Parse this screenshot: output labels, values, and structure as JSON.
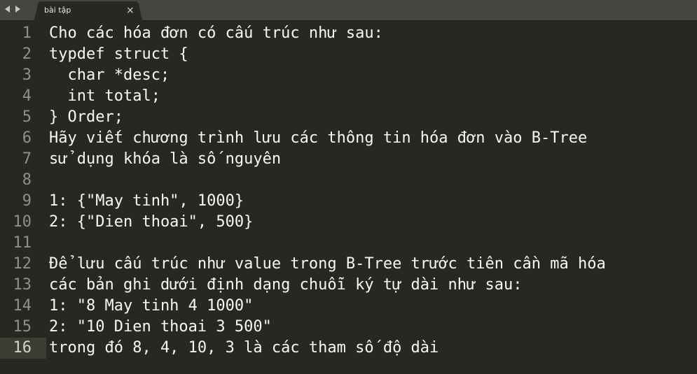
{
  "tab": {
    "title": "bài tập",
    "close_glyph": "×"
  },
  "nav": {
    "back_icon": "chevron-left-icon",
    "forward_icon": "chevron-right-icon"
  },
  "colors": {
    "background": "#272822",
    "tabbar": "#45463f",
    "text": "#f8f8f2",
    "gutter": "#8f908a",
    "current_line": "#3e3d32"
  },
  "editor": {
    "current_line": 16,
    "lines": [
      {
        "num": "1",
        "text": "Cho các hóa đơn có cấu trúc như sau:"
      },
      {
        "num": "2",
        "text": "typdef struct {"
      },
      {
        "num": "3",
        "text": "  char *desc;"
      },
      {
        "num": "4",
        "text": "  int total;"
      },
      {
        "num": "5",
        "text": "} Order;"
      },
      {
        "num": "6",
        "text": "Hãy viết chương trình lưu các thông tin hóa đơn vào B-Tree"
      },
      {
        "num": "7",
        "text": "sử dụng khóa là số nguyên"
      },
      {
        "num": "8",
        "text": ""
      },
      {
        "num": "9",
        "text": "1: {\"May tinh\", 1000}"
      },
      {
        "num": "10",
        "text": "2: {\"Dien thoai\", 500}"
      },
      {
        "num": "11",
        "text": ""
      },
      {
        "num": "12",
        "text": "Để lưu cấu trúc như value trong B-Tree trước tiên cần mã hóa"
      },
      {
        "num": "13",
        "text": "các bản ghi dưới định dạng chuỗi ký tự dài như sau:"
      },
      {
        "num": "14",
        "text": "1: \"8 May tinh 4 1000\""
      },
      {
        "num": "15",
        "text": "2: \"10 Dien thoai 3 500\""
      },
      {
        "num": "16",
        "text": "trong đó 8, 4, 10, 3 là các tham số độ dài"
      }
    ]
  }
}
